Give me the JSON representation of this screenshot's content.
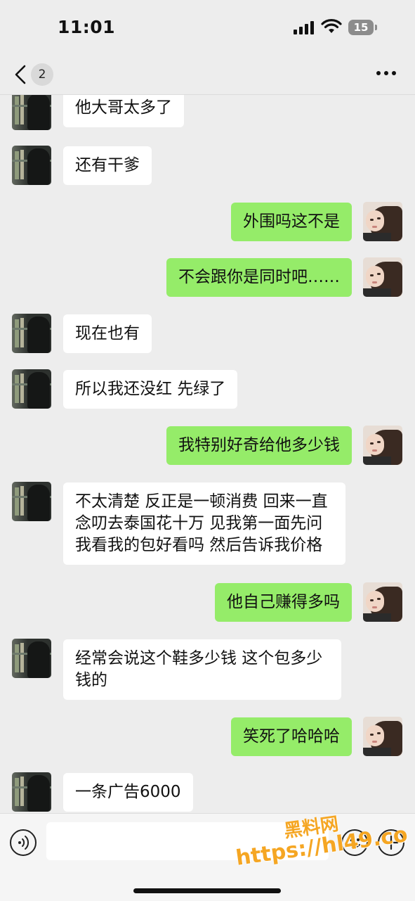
{
  "status_bar": {
    "time": "11:01",
    "battery": "15"
  },
  "nav": {
    "unread_count": "2"
  },
  "messages": [
    {
      "side": "left",
      "text": "他大哥太多了"
    },
    {
      "side": "left",
      "text": "还有干爹"
    },
    {
      "side": "right",
      "text": "外围吗这不是"
    },
    {
      "side": "right",
      "text": "不会跟你是同时吧……"
    },
    {
      "side": "left",
      "text": "现在也有"
    },
    {
      "side": "left",
      "text": "所以我还没红 先绿了"
    },
    {
      "side": "right",
      "text": "我特别好奇给他多少钱"
    },
    {
      "side": "left",
      "text": "不太清楚 反正是一顿消费 回来一直念叨去泰国花十万 见我第一面先问我看我的包好看吗 然后告诉我价格"
    },
    {
      "side": "right",
      "text": "他自己赚得多吗"
    },
    {
      "side": "left",
      "text": "经常会说这个鞋多少钱 这个包多少钱的"
    },
    {
      "side": "right",
      "text": "笑死了哈哈哈"
    },
    {
      "side": "left",
      "text": "一条广告6000"
    }
  ],
  "input": {
    "value": "",
    "placeholder": ""
  },
  "watermark": {
    "line1": "黑料网",
    "line2": "https://hl49.co"
  },
  "colors": {
    "background": "#ededed",
    "incoming_bubble": "#ffffff",
    "outgoing_bubble": "#95ec69",
    "watermark": "#f5a623"
  }
}
